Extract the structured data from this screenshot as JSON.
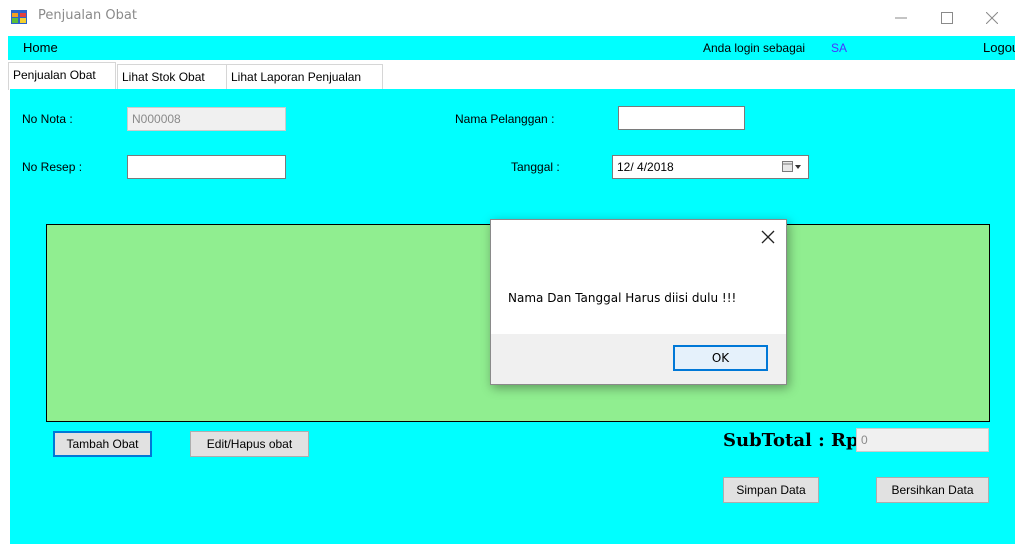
{
  "window": {
    "title": "Penjualan Obat",
    "icon": "app-form-icon",
    "controls": {
      "minimize": "—",
      "maximize": "☐",
      "close": "✕"
    }
  },
  "menu": {
    "home": "Home",
    "login_label": "Anda login sebagai",
    "login_user": "SA",
    "logout": "Logout"
  },
  "tabs": [
    {
      "label": "Penjualan Obat",
      "active": true
    },
    {
      "label": "Lihat Stok Obat",
      "active": false
    },
    {
      "label": "Lihat Laporan Penjualan",
      "active": false
    }
  ],
  "form": {
    "no_nota_label": "No Nota :",
    "no_nota_value": "N000008",
    "no_resep_label": "No Resep :",
    "no_resep_value": "",
    "nama_pelanggan_label": "Nama Pelanggan :",
    "nama_pelanggan_value": "",
    "tanggal_label": "Tanggal :",
    "tanggal_value": "12/ 4/2018"
  },
  "buttons": {
    "tambah_obat": "Tambah Obat",
    "edit_hapus": "Edit/Hapus obat",
    "simpan": "Simpan Data",
    "bersihkan": "Bersihkan Data"
  },
  "subtotal": {
    "label": "SubTotal : Rp",
    "value": "0"
  },
  "dialog": {
    "message": "Nama Dan Tanggal Harus diisi dulu !!!",
    "ok": "OK",
    "close": "✕"
  },
  "colors": {
    "background": "#00ffff",
    "grid": "#90ee90",
    "accent": "#0078d7",
    "user_highlight": "#4b33ff"
  }
}
